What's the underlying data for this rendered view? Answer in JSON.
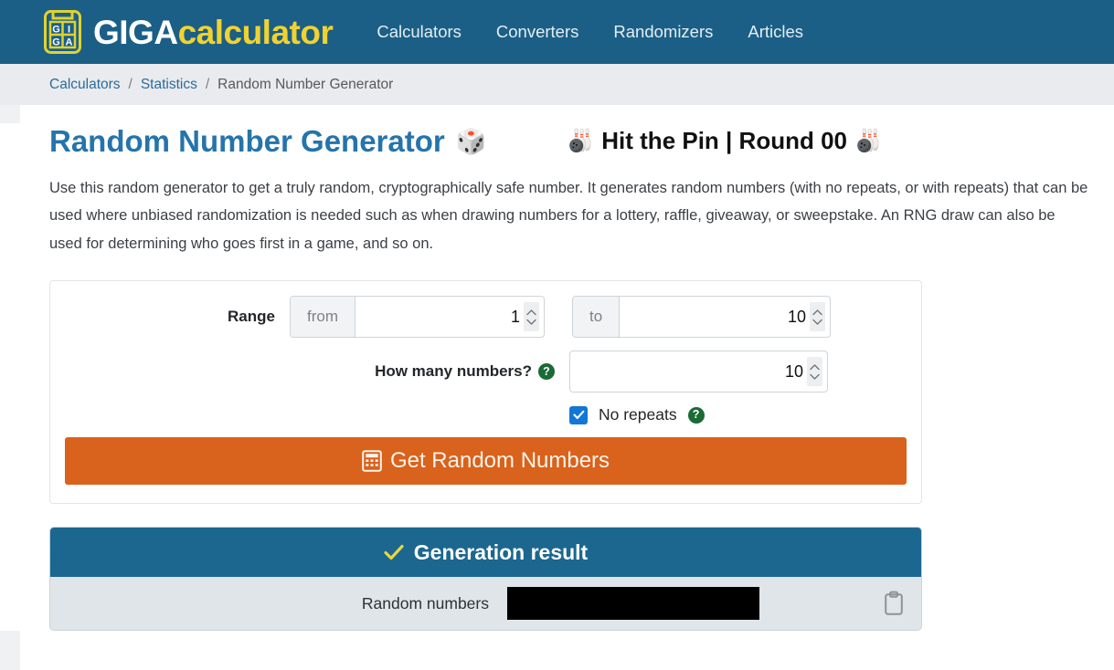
{
  "header": {
    "brand_primary": "GIGA",
    "brand_secondary": "calculator",
    "logo_icon": "calculator-logo-icon",
    "logo_cells": [
      "G",
      "I",
      "G",
      "A"
    ],
    "nav": [
      {
        "label": "Calculators",
        "name": "nav-calculators"
      },
      {
        "label": "Converters",
        "name": "nav-converters"
      },
      {
        "label": "Randomizers",
        "name": "nav-randomizers"
      },
      {
        "label": "Articles",
        "name": "nav-articles"
      }
    ],
    "colors": {
      "bar": "#1b5f86",
      "brand_accent": "#f2d230"
    }
  },
  "breadcrumb": {
    "items": [
      {
        "label": "Calculators",
        "link": true
      },
      {
        "label": "Statistics",
        "link": true
      },
      {
        "label": "Random Number Generator",
        "link": false
      }
    ],
    "separator": "/"
  },
  "page": {
    "title": "Random Number Generator",
    "title_emoji": "🎲",
    "title_color": "#2574ab",
    "description": "Use this random generator to get a truly random, cryptographically safe number. It generates random numbers (with no repeats, or with repeats) that can be used where unbiased randomization is needed such as when drawing numbers for a lottery, raffle, giveaway, or sweepstake. An RNG draw can also be used for determining who goes first in a game, and so on."
  },
  "game_banner": {
    "text": "Hit the Pin | Round 00",
    "left_emoji": "🎳",
    "right_emoji": "🎳"
  },
  "form": {
    "range_label": "Range",
    "from_prefix": "from",
    "from_value": "1",
    "to_prefix": "to",
    "to_value": "10",
    "count_label": "How many numbers?",
    "count_value": "10",
    "count_help_icon": "question-mark-icon",
    "count_help_glyph": "?",
    "no_repeats_label": "No repeats",
    "no_repeats_checked": true,
    "no_repeats_help_glyph": "?",
    "submit_label": "Get Random Numbers",
    "submit_icon": "calculator-icon",
    "submit_color": "#d9621c",
    "spinner_icon": "number-spinner-icon"
  },
  "result": {
    "header_label": "Generation result",
    "header_icon": "check-icon",
    "header_color": "#1b6790",
    "row_label": "Random numbers",
    "row_value_redacted": true,
    "copy_icon": "clipboard-copy-icon"
  }
}
